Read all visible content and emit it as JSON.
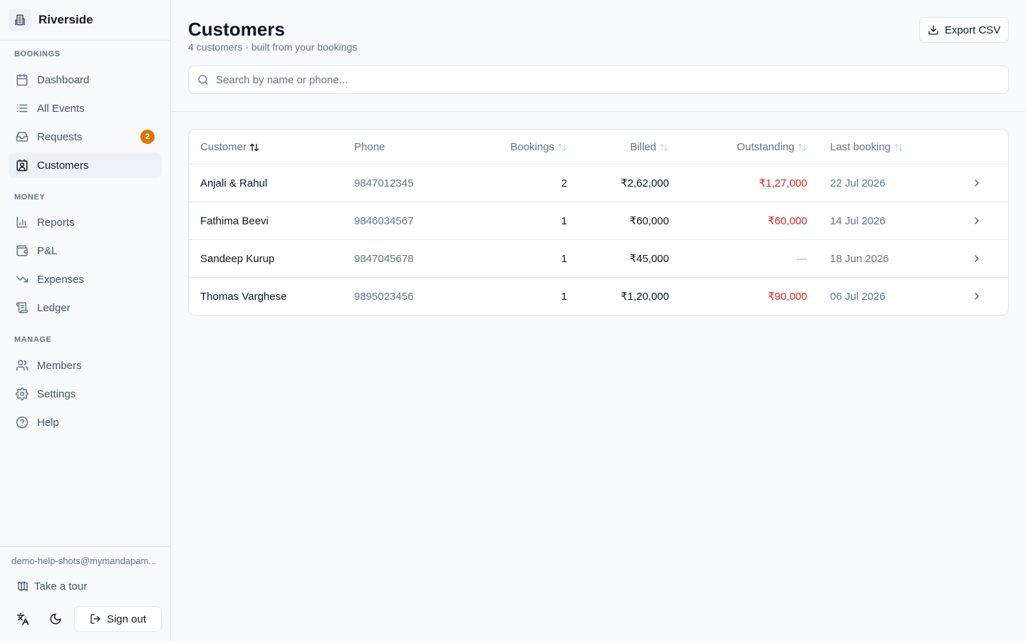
{
  "brand": {
    "name": "Riverside"
  },
  "sidebar": {
    "sections": [
      {
        "label": "BOOKINGS"
      },
      {
        "label": "MONEY"
      },
      {
        "label": "MANAGE"
      }
    ],
    "items": [
      {
        "label": "Dashboard"
      },
      {
        "label": "All Events"
      },
      {
        "label": "Requests",
        "badge": "2"
      },
      {
        "label": "Customers",
        "active": true
      },
      {
        "label": "Reports"
      },
      {
        "label": "P&L"
      },
      {
        "label": "Expenses"
      },
      {
        "label": "Ledger"
      },
      {
        "label": "Members"
      },
      {
        "label": "Settings"
      },
      {
        "label": "Help"
      }
    ],
    "footer": {
      "email": "demo-help-shots@mymandapam...",
      "tour_label": "Take a tour",
      "signout_label": "Sign out"
    }
  },
  "header": {
    "title": "Customers",
    "subtitle": "4 customers · built from your bookings",
    "export_label": "Export CSV",
    "search_placeholder": "Search by name or phone..."
  },
  "table": {
    "columns": [
      "Customer",
      "Phone",
      "Bookings",
      "Billed",
      "Outstanding",
      "Last booking"
    ],
    "rows": [
      {
        "customer": "Anjali & Rahul",
        "phone": "9847012345",
        "bookings": "2",
        "billed": "₹2,62,000",
        "outstanding": "₹1,27,000",
        "last_booking": "22 Jul 2026"
      },
      {
        "customer": "Fathima Beevi",
        "phone": "9846034567",
        "bookings": "1",
        "billed": "₹60,000",
        "outstanding": "₹60,000",
        "last_booking": "14 Jul 2026"
      },
      {
        "customer": "Sandeep Kurup",
        "phone": "9847045678",
        "bookings": "1",
        "billed": "₹45,000",
        "outstanding": "—",
        "last_booking": "18 Jun 2026"
      },
      {
        "customer": "Thomas Varghese",
        "phone": "9895023456",
        "bookings": "1",
        "billed": "₹1,20,000",
        "outstanding": "₹90,000",
        "last_booking": "06 Jul 2026"
      }
    ]
  },
  "colors": {
    "accent_badge": "#d97706",
    "outstanding": "#dc2626",
    "muted_text": "#64748b"
  }
}
